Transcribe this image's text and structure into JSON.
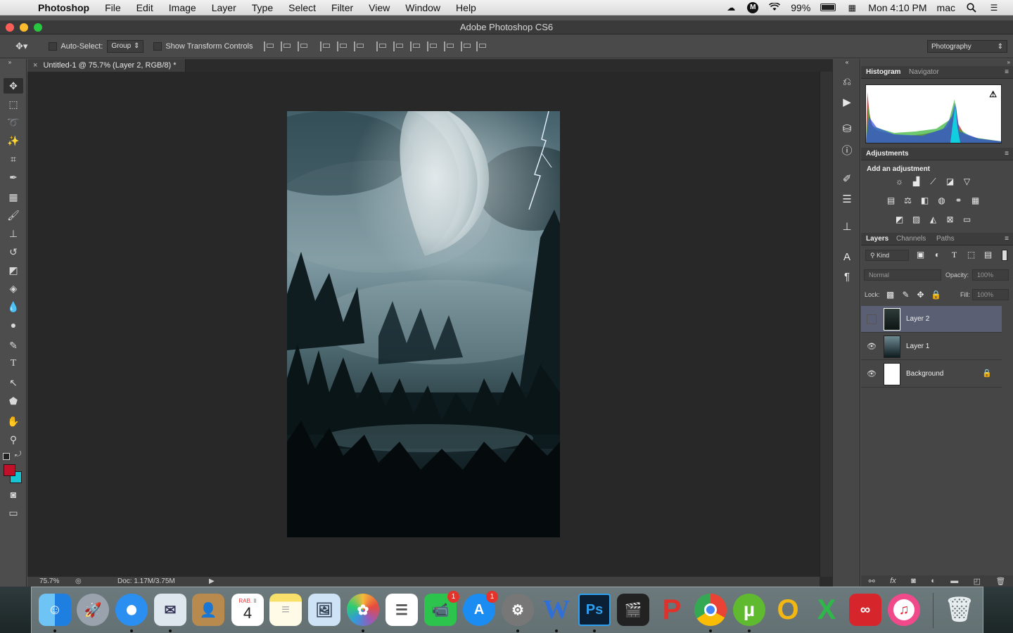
{
  "menubar": {
    "app_name": "Photoshop",
    "items": [
      "File",
      "Edit",
      "Image",
      "Layer",
      "Type",
      "Select",
      "Filter",
      "View",
      "Window",
      "Help"
    ],
    "battery": "99%",
    "clock": "Mon 4:10 PM",
    "user": "mac"
  },
  "window": {
    "title": "Adobe Photoshop CS6"
  },
  "options_bar": {
    "auto_select_label": "Auto-Select:",
    "auto_select_value": "Group",
    "transform_controls_label": "Show Transform Controls",
    "workspace": "Photography"
  },
  "document": {
    "tab_title": "Untitled-1 @ 75.7% (Layer 2, RGB/8) *",
    "zoom": "75.7%",
    "doc_size": "Doc: 1.17M/3.75M"
  },
  "colors": {
    "foreground": "#c0102a",
    "background": "#19c4d2",
    "selection": "#5a5f73",
    "accent": "#2d7ef7"
  },
  "panels": {
    "top_tabs": [
      "Histogram",
      "Navigator"
    ],
    "adjustments_tab": "Adjustments",
    "adjustments_title": "Add an adjustment",
    "layer_tabs": [
      "Layers",
      "Channels",
      "Paths"
    ],
    "kind_filter": "Kind",
    "blend_mode": "Normal",
    "opacity_label": "Opacity:",
    "opacity_value": "100%",
    "lock_label": "Lock:",
    "fill_label": "Fill:",
    "fill_value": "100%"
  },
  "layers": [
    {
      "name": "Layer 2",
      "visible": false,
      "selected": true,
      "locked": false
    },
    {
      "name": "Layer 1",
      "visible": true,
      "selected": false,
      "locked": false
    },
    {
      "name": "Background",
      "visible": true,
      "selected": false,
      "locked": true
    }
  ],
  "dock": {
    "apps": [
      "Finder",
      "Launchpad",
      "Safari",
      "Mail",
      "Contacts",
      "Calendar",
      "Notes",
      "Preview",
      "Photos",
      "Reminders",
      "FaceTime",
      "App Store",
      "System Preferences",
      "Word",
      "Photoshop",
      "Final Cut Pro",
      "WPS",
      "Chrome",
      "uTorrent",
      "Opera",
      "Excel",
      "Creative Cloud",
      "iTunes",
      "Trash"
    ],
    "calendar_month": "RAB. II",
    "calendar_day": "4",
    "facetime_badge": "1",
    "appstore_badge": "1"
  }
}
